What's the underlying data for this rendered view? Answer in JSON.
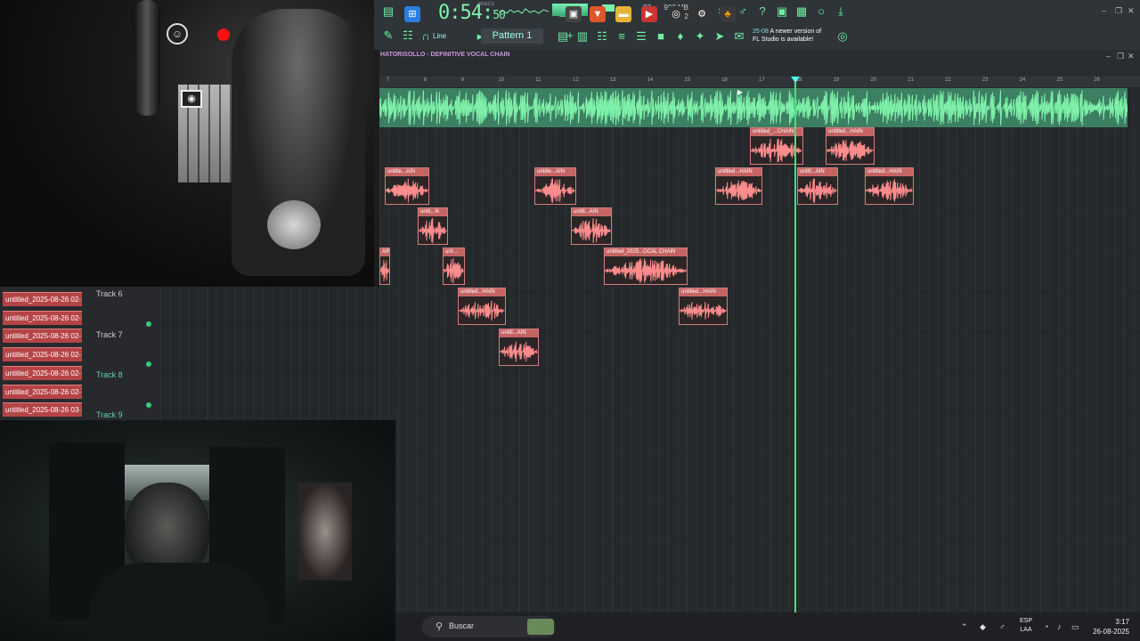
{
  "toolbar": {
    "time_main": "0:54:",
    "time_sec": "50",
    "time_unit": "MSECS",
    "cpu": "27",
    "memory": "983 MB",
    "memory_sub": "2",
    "snap_mode": "Line",
    "pattern": "Pattern 1",
    "news_date": "25-08",
    "news_text_1": "A newer version of",
    "news_text_2": "FL Studio is available!"
  },
  "playlist": {
    "title": "HATORISOLLO - DEFINITIVE VOCAL CHAIN",
    "ruler_ticks": [
      "7",
      "8",
      "9",
      "10",
      "11",
      "12",
      "13",
      "14",
      "15",
      "16",
      "17",
      "18",
      "19",
      "20",
      "21",
      "22",
      "23",
      "24",
      "25",
      "26"
    ],
    "clips": [
      {
        "label": "untitled_...CHAIN"
      },
      {
        "label": "untitled...HAIN"
      },
      {
        "label": "untitle...AIN"
      },
      {
        "label": "untitle...AIN"
      },
      {
        "label": "untitled...HAIN"
      },
      {
        "label": "untitl...AIN"
      },
      {
        "label": "untitled...HAIN"
      },
      {
        "label": "untit...N"
      },
      {
        "label": "untitl...AIN"
      },
      {
        "label": "AIN"
      },
      {
        "label": "unt..."
      },
      {
        "label": "untitled_2025...OCAL CHAIN"
      },
      {
        "label": "untitled...HAIN"
      },
      {
        "label": "untitled...HAIN"
      },
      {
        "label": "untitl...AIN"
      }
    ]
  },
  "tracks": {
    "names": [
      "Track 6",
      "Track 7",
      "Track 8",
      "Track 9"
    ],
    "channels": [
      "untitled_2025-08-26 02-",
      "untitled_2025-08-26 02-",
      "untitled_2025-08-26 02-",
      "untitled_2025-08-26 02-",
      "untitled_2025-08-26 02-",
      "untitled_2025-08-26 02-",
      "untitled_2025-08-26 03-"
    ]
  },
  "taskbar": {
    "search_label": "Buscar",
    "lang_1": "ESP",
    "lang_2": "LAA",
    "time": "3:17",
    "date": "26-08-2025"
  },
  "colors": {
    "accent": "#6ff0a2",
    "clip": "#c56464",
    "playhead": "#3fe47f"
  }
}
